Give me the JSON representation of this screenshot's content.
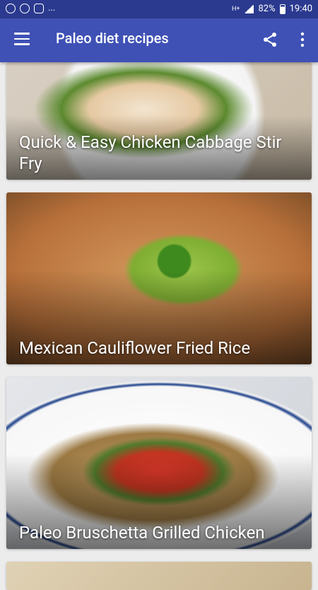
{
  "status_bar": {
    "battery": "82%",
    "time": "19:40",
    "overflow_dots": "...",
    "network": "H+"
  },
  "app_bar": {
    "title": "Paleo diet recipes"
  },
  "recipes": [
    {
      "title": "Quick & Easy Chicken Cabbage Stir Fry"
    },
    {
      "title": "Mexican Cauliflower Fried Rice"
    },
    {
      "title": "Paleo Bruschetta Grilled Chicken"
    },
    {
      "title": ""
    }
  ],
  "icons": {
    "menu": "hamburger-menu-icon",
    "share": "share-icon",
    "more": "more-vert-icon"
  },
  "colors": {
    "app_bar": "#3f51b5",
    "status_bar": "#2b3a8f"
  }
}
